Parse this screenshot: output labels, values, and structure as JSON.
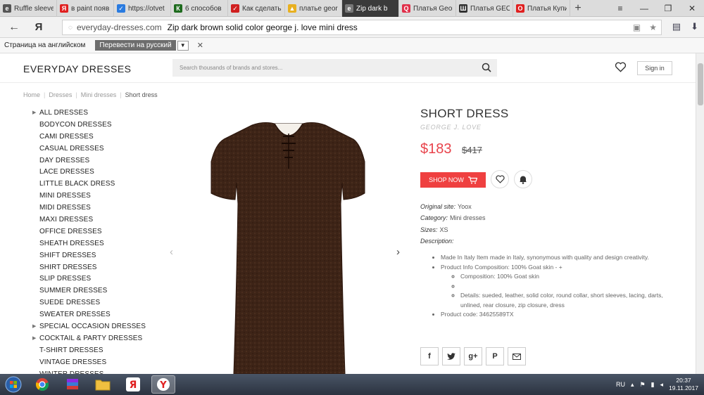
{
  "browser": {
    "tabs": [
      {
        "title": "Ruffle sleeve",
        "icon_color": "#555555",
        "icon_letter": "e",
        "active": false
      },
      {
        "title": "в paint появ",
        "icon_color": "#e02020",
        "icon_letter": "Я",
        "active": false
      },
      {
        "title": "https://otvet",
        "icon_color": "#2a7be0",
        "icon_letter": "✓",
        "active": false
      },
      {
        "title": "6 способов",
        "icon_color": "#1e6b1e",
        "icon_letter": "К",
        "active": false
      },
      {
        "title": "Как сделать",
        "icon_color": "#d02020",
        "icon_letter": "✓",
        "active": false
      },
      {
        "title": "платье geor",
        "icon_color": "#e8b020",
        "icon_letter": "▲",
        "active": false
      },
      {
        "title": "Zip dark b",
        "icon_color": "#777777",
        "icon_letter": "e",
        "active": true
      },
      {
        "title": "Платья Geor",
        "icon_color": "#e0304a",
        "icon_letter": "Q",
        "active": false
      },
      {
        "title": "Платья GEO",
        "icon_color": "#333333",
        "icon_letter": "Ш",
        "active": false
      },
      {
        "title": "Платья Купи",
        "icon_color": "#e02020",
        "icon_letter": "O",
        "active": false
      }
    ],
    "address": {
      "domain": "everyday-dresses.com",
      "page_title": "Zip dark brown solid color george j. love mini dress"
    },
    "translate_bar": {
      "message": "Страница на английском",
      "button": "Перевести на русский"
    }
  },
  "site": {
    "brand": "EVERYDAY DRESSES",
    "search_placeholder": "Search thousands of brands and stores...",
    "signin": "Sign in"
  },
  "breadcrumb": [
    "Home",
    "Dresses",
    "Mini dresses",
    "Short dress"
  ],
  "categories": [
    {
      "label": "ALL DRESSES",
      "arrow": true
    },
    {
      "label": "BODYCON DRESSES",
      "arrow": false
    },
    {
      "label": "CAMI DRESSES",
      "arrow": false
    },
    {
      "label": "CASUAL DRESSES",
      "arrow": false
    },
    {
      "label": "DAY DRESSES",
      "arrow": false
    },
    {
      "label": "LACE DRESSES",
      "arrow": false
    },
    {
      "label": "LITTLE BLACK DRESS",
      "arrow": false
    },
    {
      "label": "MINI DRESSES",
      "arrow": false
    },
    {
      "label": "MIDI DRESSES",
      "arrow": false
    },
    {
      "label": "MAXI DRESSES",
      "arrow": false
    },
    {
      "label": "OFFICE DRESSES",
      "arrow": false
    },
    {
      "label": "SHEATH DRESSES",
      "arrow": false
    },
    {
      "label": "SHIFT DRESSES",
      "arrow": false
    },
    {
      "label": "SHIRT DRESSES",
      "arrow": false
    },
    {
      "label": "SLIP DRESSES",
      "arrow": false
    },
    {
      "label": "SUMMER DRESSES",
      "arrow": false
    },
    {
      "label": "SUEDE DRESSES",
      "arrow": false
    },
    {
      "label": "SWEATER DRESSES",
      "arrow": false
    },
    {
      "label": "SPECIAL OCCASION DRESSES",
      "arrow": true
    },
    {
      "label": "COCKTAIL & PARTY DRESSES",
      "arrow": true
    },
    {
      "label": "T-SHIRT DRESSES",
      "arrow": false
    },
    {
      "label": "VINTAGE DRESSES",
      "arrow": false
    },
    {
      "label": "WINTER DRESSES",
      "arrow": false
    }
  ],
  "product": {
    "title": "SHORT DRESS",
    "brand": "GEORGE J. LOVE",
    "price": "$183",
    "old_price": "$417",
    "shop_now": "SHOP NOW",
    "details": [
      {
        "label": "Original site:",
        "value": "Yoox"
      },
      {
        "label": "Category:",
        "value": "Mini dresses"
      },
      {
        "label": "Sizes:",
        "value": "XS"
      },
      {
        "label": "Description:",
        "value": ""
      }
    ],
    "description": {
      "item1": "Made In Italy Item made in Italy, synonymous with quality and design creativity.",
      "item2": "Product Info Composition: 100% Goat skin - +",
      "sub1": "Composition: 100% Goat skin",
      "sub2": "",
      "sub3": "Details: sueded, leather, solid color, round collar, short sleeves, lacing, darts, unlined, rear closure, zip closure, dress",
      "item3": "Product code: 34625589TX"
    },
    "dress_color": "#3d2417"
  },
  "accent_color": "#ef4040",
  "taskbar": {
    "lang": "RU",
    "time": "20:37",
    "date": "19.11.2017"
  }
}
